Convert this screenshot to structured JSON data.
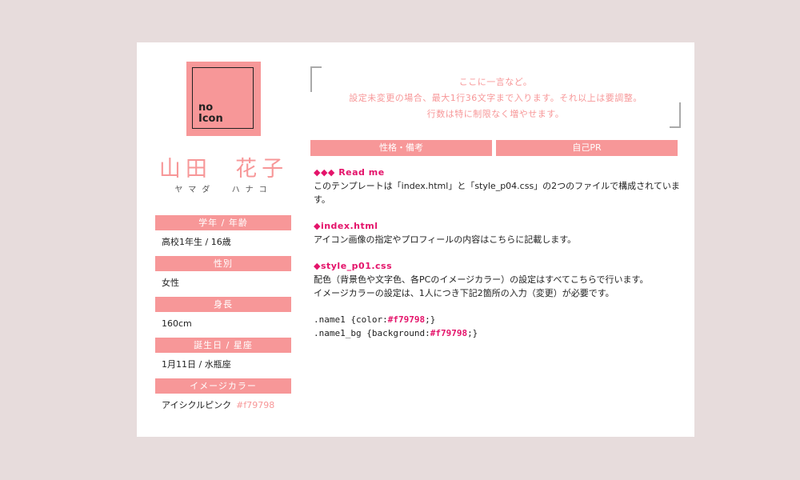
{
  "profile": {
    "avatar_line1": "no",
    "avatar_line2": "Icon",
    "name": "山田  花子",
    "furigana": "ヤマダ  ハナコ",
    "items": [
      {
        "label": "学年 / 年齢",
        "value": "高校1年生 / 16歳"
      },
      {
        "label": "性別",
        "value": "女性"
      },
      {
        "label": "身長",
        "value": "160cm"
      },
      {
        "label": "誕生日 / 星座",
        "value": "1月11日 / 水瓶座"
      },
      {
        "label": "イメージカラー",
        "value": "アイシクルピンク",
        "hex": "#f79798"
      }
    ]
  },
  "quote": {
    "line1": "ここに一言など。",
    "line2": "設定未変更の場合、最大1行36文字まで入ります。それ以上は要調整。",
    "line3": "行数は特に制限なく増やせます。"
  },
  "tabs": {
    "left": "性格・備考",
    "right": "自己PR"
  },
  "content": {
    "readme_title": "◆◆◆ Read me",
    "readme_body": "このテンプレートは「index.html」と「style_p04.css」の2つのファイルで構成されています。",
    "index_title": "◆index.html",
    "index_body": "アイコン画像の指定やプロフィールの内容はこちらに記載します。",
    "css_title": "◆style_p01.css",
    "css_body1": "配色（背景色や文字色、各PCのイメージカラー）の設定はすべてこちらで行います。",
    "css_body2": "イメージカラーの設定は、1人につき下記2箇所の入力（変更）が必要です。",
    "code1_pre": ".name1 {color:",
    "code1_hex": "#f79798",
    "code1_post": ";}",
    "code2_pre": ".name1_bg {background:",
    "code2_hex": "#f79798",
    "code2_post": ";}"
  },
  "colors": {
    "accent": "#f79798",
    "highlight": "#e4136a",
    "page_bg": "#e7dcdc",
    "card_bg": "#ffffff"
  }
}
